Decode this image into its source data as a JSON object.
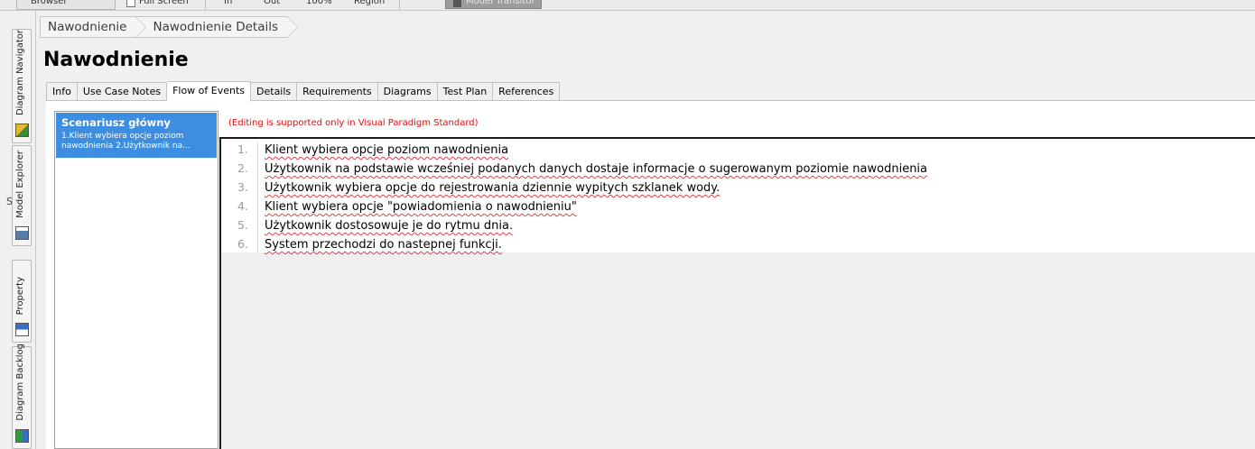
{
  "toolbar": {
    "left_label": "Browser",
    "full_screen_label": "Full Screen",
    "item_a": "In",
    "item_b": "Out",
    "item_c": "100%",
    "item_d": "Region",
    "highlight_label": "Model Transitor"
  },
  "side_tabs": [
    {
      "label": "Diagram Navigator"
    },
    {
      "label": "Model Explorer"
    },
    {
      "label": "Property"
    },
    {
      "label": "Diagram Backlog"
    }
  ],
  "stray_text": "S",
  "breadcrumb": [
    "Nawodnienie",
    "Nawodnienie Details"
  ],
  "page_title": "Nawodnienie",
  "tabs": [
    {
      "label": "Info"
    },
    {
      "label": "Use Case Notes"
    },
    {
      "label": "Flow of Events"
    },
    {
      "label": "Details"
    },
    {
      "label": "Requirements"
    },
    {
      "label": "Diagrams"
    },
    {
      "label": "Test Plan"
    },
    {
      "label": "References"
    }
  ],
  "active_tab": "Flow of Events",
  "scenario": {
    "title": "Scenariusz główny",
    "preview_line1": "1.Klient wybiera opcje poziom",
    "preview_line2": "nawodnienia 2.Użytkownik na..."
  },
  "edit_notice": "(Editing is supported only in Visual Paradigm Standard)",
  "steps": [
    {
      "num": "1.",
      "text": "Klient wybiera opcje poziom nawodnienia"
    },
    {
      "num": "2.",
      "text": "Użytkownik na podstawie wcześniej podanych danych dostaje informacje o sugerowanym poziomie nawodnienia"
    },
    {
      "num": "3.",
      "text": "Użytkownik wybiera opcje do rejestrowania dziennie wypitych szklanek wody."
    },
    {
      "num": "4.",
      "text": "Klient wybiera opcje \"powiadomienia o nawodnieniu\""
    },
    {
      "num": "5.",
      "text": "Użytkownik dostosowuje je do rytmu dnia."
    },
    {
      "num": "6.",
      "text": "System przechodzi do nastepnej funkcji."
    }
  ],
  "colors": {
    "selection": "#3d8ee0",
    "notice": "#e01010"
  }
}
